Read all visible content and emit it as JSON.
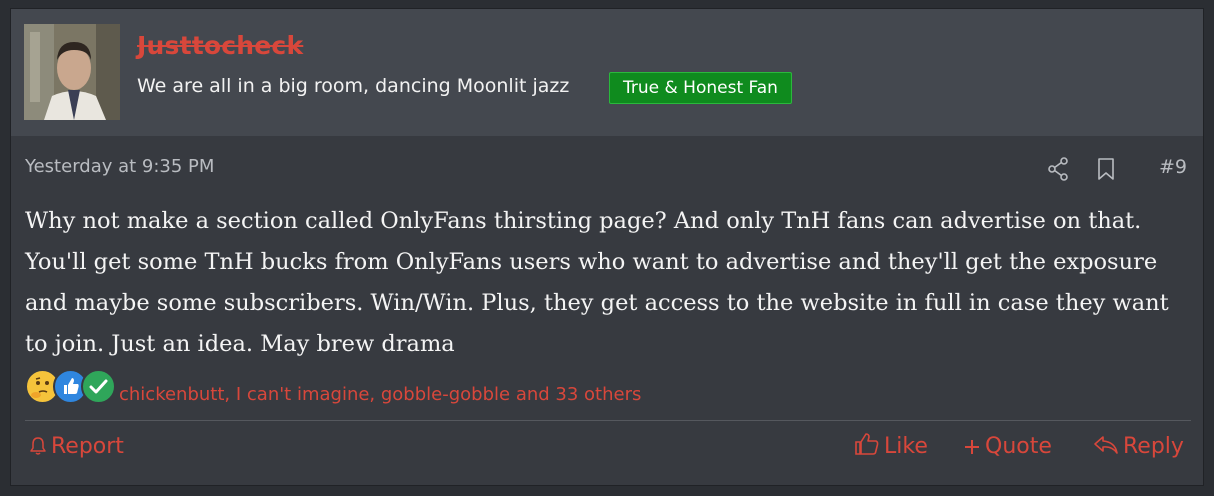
{
  "post": {
    "username": "Justtocheck",
    "user_title": "We are all in a big room, dancing Moonlit jazz",
    "user_banner": "True & Honest Fan",
    "date": "Yesterday at 9:35 PM",
    "post_number": "#9",
    "body": "Why not make a section called OnlyFans thirsting page? And only TnH fans can advertise on that. You'll get some TnH bucks from OnlyFans users who want to advertise and they'll get the exposure and maybe some subscribers. Win/Win. Plus, they get access to the website in full in case they want to join. Just an idea. May brew drama",
    "reactions": {
      "icons": [
        "thinking-face-icon",
        "thumbs-up-icon",
        "checkmark-icon"
      ],
      "summary": "chickenbutt, I can't imagine, gobble-gobble and 33 others"
    }
  },
  "actions": {
    "report": "Report",
    "like": "Like",
    "quote": "Quote",
    "reply": "Reply"
  },
  "icons": {
    "share": "share-icon",
    "bookmark": "bookmark-icon",
    "report": "bell-icon",
    "like": "thumbs-up-outline-icon",
    "quote": "plus-icon",
    "reply": "reply-arrow-icon"
  },
  "colors": {
    "accent": "#d8473b",
    "banner": "#0f8b1e",
    "background": "#373a40",
    "header": "#44484f"
  }
}
